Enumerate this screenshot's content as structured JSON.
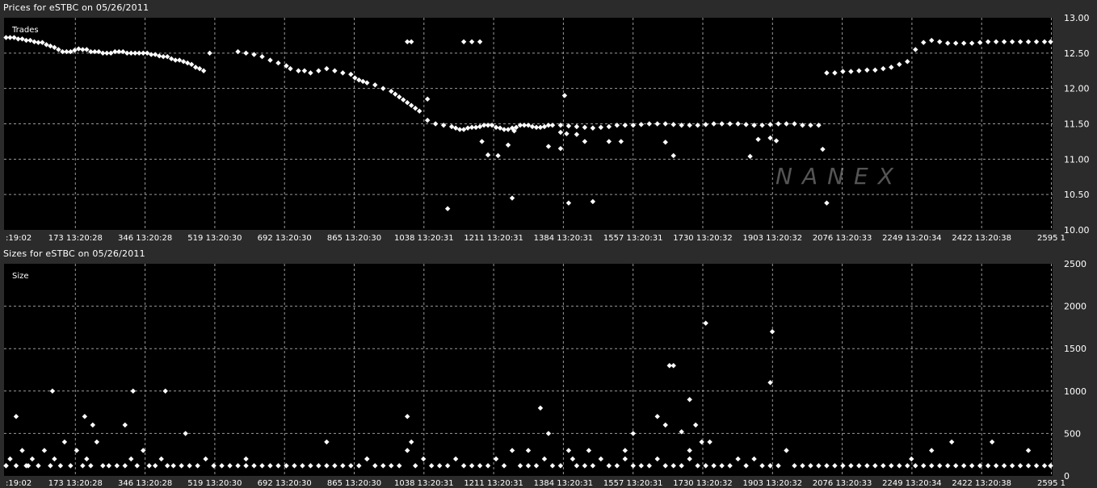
{
  "panels": {
    "prices_title": "Prices for  eSTBC  on  05/26/2011",
    "sizes_title": "Sizes for  eSTBC  on  05/26/2011"
  },
  "colors": {
    "background": "#2b2b2b",
    "plot": "#000000",
    "grid": "#9a9a9a",
    "marker": "#ffffff"
  },
  "chart_data": [
    {
      "type": "scatter",
      "title": "Prices for  eSTBC  on  05/26/2011",
      "plot_label": "Trades",
      "watermark": "NANEX",
      "xlim": [
        0,
        2600
      ],
      "ylim": [
        10.0,
        13.0
      ],
      "yticks": [
        10.0,
        10.5,
        11.0,
        11.5,
        12.0,
        12.5,
        13.0
      ],
      "ytick_labels": [
        "10.00",
        "10.50",
        "11.00",
        "11.50",
        "12.00",
        "12.50",
        "13.00"
      ],
      "xtick_labels": [
        ":19:02",
        "173 13:20:28",
        "346 13:20:28",
        "519 13:20:30",
        "692 13:20:30",
        "865 13:20:30",
        "1038 13:20:31",
        "1211 13:20:31",
        "1384 13:20:31",
        "1557 13:20:31",
        "1730 13:20:32",
        "1903 13:20:32",
        "2076 13:20:33",
        "2249 13:20:34",
        "2422 13:20:38",
        "2595 1"
      ],
      "grid": true,
      "x": [
        5,
        15,
        25,
        35,
        45,
        55,
        65,
        75,
        85,
        95,
        105,
        115,
        125,
        135,
        145,
        155,
        165,
        175,
        185,
        195,
        205,
        215,
        225,
        235,
        245,
        255,
        265,
        275,
        285,
        295,
        305,
        315,
        325,
        335,
        345,
        355,
        365,
        375,
        385,
        395,
        405,
        415,
        425,
        435,
        445,
        455,
        465,
        475,
        485,
        495,
        510,
        580,
        600,
        620,
        640,
        660,
        680,
        700,
        710,
        730,
        745,
        760,
        780,
        800,
        820,
        840,
        860,
        870,
        880,
        890,
        900,
        920,
        940,
        960,
        970,
        980,
        990,
        1000,
        1010,
        1020,
        1030,
        1050,
        1070,
        1090,
        1110,
        1120,
        1130,
        1140,
        1150,
        1160,
        1170,
        1180,
        1190,
        1200,
        1210,
        1220,
        1230,
        1240,
        1250,
        1260,
        1270,
        1280,
        1290,
        1300,
        1310,
        1320,
        1330,
        1340,
        1350,
        1360,
        1380,
        1400,
        1420,
        1440,
        1460,
        1480,
        1500,
        1520,
        1540,
        1560,
        1580,
        1600,
        1620,
        1640,
        1660,
        1680,
        1700,
        1720,
        1740,
        1760,
        1780,
        1800,
        1820,
        1840,
        1860,
        1880,
        1900,
        1920,
        1940,
        1960,
        1980,
        2000,
        2020,
        2040,
        2060,
        2080,
        2100,
        2120,
        2140,
        2160,
        2180,
        2200,
        2220,
        2240,
        2260,
        2280,
        2300,
        2320,
        2340,
        2360,
        2380,
        2400,
        2420,
        2440,
        2460,
        2480,
        2500,
        2520,
        2540,
        2560,
        2580,
        2595,
        1000,
        1010,
        1140,
        1160,
        1180,
        1200,
        1225,
        1265,
        1380,
        1395,
        1420,
        1440,
        1500,
        1530,
        1640,
        1660,
        1850,
        1870,
        1900,
        1915,
        1185,
        1250,
        1350,
        1380,
        2030,
        2040,
        1400,
        1460,
        1260,
        1390,
        1050,
        1100
      ],
      "y": [
        12.72,
        12.72,
        12.72,
        12.7,
        12.7,
        12.68,
        12.68,
        12.66,
        12.65,
        12.65,
        12.62,
        12.6,
        12.58,
        12.55,
        12.52,
        12.52,
        12.52,
        12.54,
        12.56,
        12.55,
        12.55,
        12.52,
        12.52,
        12.52,
        12.5,
        12.5,
        12.5,
        12.52,
        12.52,
        12.52,
        12.5,
        12.5,
        12.5,
        12.5,
        12.5,
        12.5,
        12.48,
        12.48,
        12.46,
        12.45,
        12.45,
        12.42,
        12.4,
        12.4,
        12.38,
        12.36,
        12.34,
        12.3,
        12.28,
        12.25,
        12.5,
        12.52,
        12.5,
        12.48,
        12.45,
        12.4,
        12.36,
        12.32,
        12.28,
        12.25,
        12.25,
        12.22,
        12.25,
        12.28,
        12.25,
        12.22,
        12.2,
        12.15,
        12.12,
        12.1,
        12.08,
        12.05,
        12.0,
        11.96,
        11.92,
        11.88,
        11.84,
        11.8,
        11.76,
        11.72,
        11.68,
        11.55,
        11.5,
        11.48,
        11.46,
        11.44,
        11.42,
        11.42,
        11.44,
        11.45,
        11.45,
        11.46,
        11.48,
        11.48,
        11.48,
        11.45,
        11.44,
        11.42,
        11.42,
        11.44,
        11.45,
        11.48,
        11.48,
        11.48,
        11.46,
        11.45,
        11.45,
        11.46,
        11.48,
        11.48,
        11.48,
        11.47,
        11.46,
        11.45,
        11.44,
        11.45,
        11.46,
        11.48,
        11.48,
        11.48,
        11.49,
        11.5,
        11.5,
        11.5,
        11.49,
        11.48,
        11.48,
        11.48,
        11.49,
        11.5,
        11.5,
        11.5,
        11.5,
        11.49,
        11.48,
        11.48,
        11.49,
        11.5,
        11.5,
        11.5,
        11.48,
        11.48,
        11.48,
        12.22,
        12.22,
        12.24,
        12.24,
        12.25,
        12.26,
        12.26,
        12.28,
        12.3,
        12.34,
        12.38,
        12.55,
        12.65,
        12.68,
        12.66,
        12.64,
        12.64,
        12.64,
        12.64,
        12.65,
        12.66,
        12.66,
        12.66,
        12.66,
        12.66,
        12.66,
        12.66,
        12.66,
        12.66,
        12.66,
        12.66,
        12.66,
        12.66,
        12.66,
        11.06,
        11.05,
        11.4,
        11.38,
        11.36,
        11.35,
        11.25,
        11.25,
        11.25,
        11.24,
        11.05,
        11.04,
        11.28,
        11.3,
        11.26,
        11.25,
        11.2,
        11.18,
        11.15,
        11.14,
        10.38,
        10.38,
        10.4,
        10.45,
        11.9,
        11.85,
        10.3,
        10.65,
        12.02,
        11.76,
        10.4,
        10.4
      ]
    },
    {
      "type": "scatter",
      "title": "Sizes for  eSTBC  on  05/26/2011",
      "plot_label": "Size",
      "xlim": [
        0,
        2600
      ],
      "ylim": [
        0,
        2500
      ],
      "yticks": [
        0,
        500,
        1000,
        1500,
        2000,
        2500
      ],
      "ytick_labels": [
        "0",
        "500",
        "1000",
        "1500",
        "2000",
        "2500"
      ],
      "xtick_labels": [
        ":19:02",
        "173 13:20:28",
        "346 13:20:28",
        "519 13:20:30",
        "692 13:20:30",
        "865 13:20:30",
        "1038 13:20:31",
        "1211 13:20:31",
        "1384 13:20:31",
        "1557 13:20:31",
        "1730 13:20:32",
        "1903 13:20:32",
        "2076 13:20:33",
        "2249 13:20:34",
        "2422 13:20:38",
        "2595 1"
      ],
      "grid": true,
      "x": [
        5,
        15,
        30,
        45,
        55,
        70,
        85,
        100,
        115,
        125,
        140,
        150,
        165,
        180,
        195,
        205,
        215,
        230,
        245,
        260,
        280,
        300,
        315,
        330,
        345,
        360,
        375,
        390,
        405,
        420,
        440,
        460,
        480,
        500,
        520,
        540,
        560,
        580,
        600,
        620,
        640,
        660,
        680,
        700,
        720,
        740,
        760,
        780,
        800,
        820,
        840,
        860,
        880,
        900,
        920,
        940,
        960,
        980,
        1000,
        1020,
        1040,
        1060,
        1080,
        1100,
        1120,
        1140,
        1160,
        1180,
        1200,
        1220,
        1240,
        1260,
        1280,
        1300,
        1320,
        1340,
        1360,
        1380,
        1400,
        1420,
        1440,
        1460,
        1480,
        1500,
        1520,
        1540,
        1560,
        1580,
        1600,
        1620,
        1640,
        1660,
        1680,
        1700,
        1720,
        1740,
        1760,
        1780,
        1800,
        1820,
        1840,
        1860,
        1880,
        1900,
        1920,
        1940,
        1960,
        1980,
        2000,
        2020,
        2040,
        2060,
        2080,
        2100,
        2120,
        2140,
        2160,
        2180,
        2200,
        2220,
        2240,
        2260,
        2280,
        2300,
        2320,
        2340,
        2360,
        2380,
        2400,
        2420,
        2440,
        2460,
        2480,
        2500,
        2520,
        2540,
        2560,
        2580,
        2595,
        5,
        60,
        200,
        220,
        400,
        1000,
        1010,
        1330,
        1620,
        1640,
        1680,
        1700,
        1715,
        1740,
        1900,
        1905,
        1650,
        1660,
        30,
        120,
        300,
        320,
        450,
        600,
        800,
        900,
        1300,
        1350,
        1410,
        1450,
        1540,
        1560,
        1700,
        1730,
        1750,
        2250,
        2300,
        2350,
        2450,
        2540
      ],
      "y": [
        120,
        200,
        120,
        300,
        120,
        200,
        120,
        300,
        120,
        200,
        120,
        400,
        120,
        300,
        120,
        200,
        120,
        400,
        120,
        120,
        120,
        120,
        200,
        120,
        300,
        120,
        120,
        200,
        120,
        120,
        120,
        120,
        120,
        200,
        120,
        120,
        120,
        120,
        120,
        120,
        120,
        120,
        120,
        120,
        120,
        120,
        120,
        120,
        120,
        120,
        120,
        120,
        120,
        200,
        120,
        120,
        120,
        120,
        300,
        120,
        200,
        120,
        120,
        120,
        200,
        120,
        120,
        120,
        120,
        200,
        120,
        300,
        120,
        120,
        120,
        200,
        120,
        120,
        300,
        120,
        120,
        120,
        200,
        120,
        120,
        200,
        120,
        120,
        120,
        200,
        120,
        120,
        120,
        200,
        120,
        120,
        120,
        120,
        120,
        200,
        120,
        200,
        120,
        120,
        120,
        300,
        120,
        120,
        120,
        120,
        120,
        120,
        120,
        120,
        120,
        120,
        120,
        120,
        120,
        120,
        120,
        120,
        120,
        120,
        120,
        120,
        120,
        120,
        120,
        120,
        120,
        120,
        120,
        120,
        120,
        120,
        120,
        120,
        120,
        120,
        120,
        700,
        600,
        1000,
        700,
        400,
        800,
        700,
        600,
        520,
        900,
        600,
        1800,
        1100,
        1700,
        1300,
        1300,
        700,
        1000,
        600,
        1000,
        500,
        200,
        400,
        200,
        300,
        500,
        200,
        300,
        300,
        500,
        300,
        400,
        400,
        200,
        300,
        400,
        400,
        300,
        400,
        400,
        500
      ]
    }
  ]
}
